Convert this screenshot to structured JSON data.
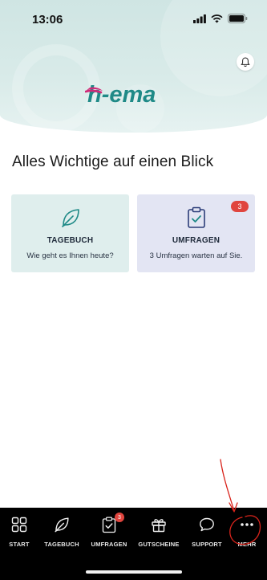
{
  "status_bar": {
    "time": "13:06"
  },
  "header": {
    "logo_text": "h-ema",
    "brand_color_teal": "#1f8a87",
    "brand_color_pink": "#d02a78"
  },
  "main": {
    "headline": "Alles Wichtige auf einen Blick",
    "cards": [
      {
        "title": "TAGEBUCH",
        "subtitle": "Wie geht es Ihnen heute?",
        "icon": "leaf-icon"
      },
      {
        "title": "UMFRAGEN",
        "subtitle": "3 Umfragen warten auf Sie.",
        "icon": "clipboard-check-icon",
        "badge": "3"
      }
    ]
  },
  "tabbar": {
    "items": [
      {
        "label": "START",
        "icon": "grid-icon"
      },
      {
        "label": "TAGEBUCH",
        "icon": "leaf-icon"
      },
      {
        "label": "UMFRAGEN",
        "icon": "clipboard-check-icon",
        "badge": "3"
      },
      {
        "label": "GUTSCHEINE",
        "icon": "gift-icon"
      },
      {
        "label": "SUPPORT",
        "icon": "chat-bubble-icon"
      },
      {
        "label": "MEHR",
        "icon": "more-dots-icon"
      }
    ]
  },
  "colors": {
    "accent": "#1f8a87",
    "badge": "#e0453e",
    "annotation": "#d9241c"
  }
}
